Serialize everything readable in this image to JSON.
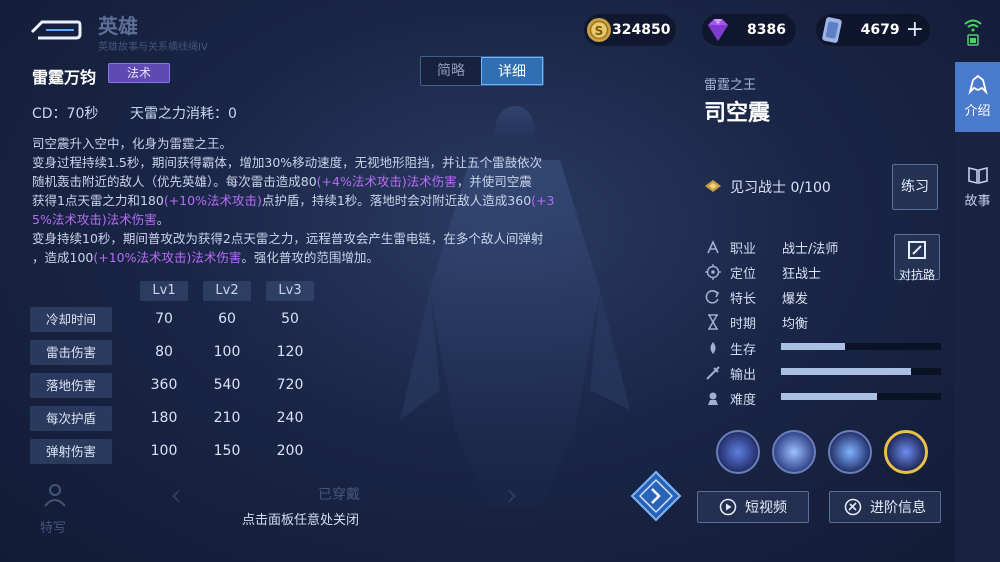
{
  "header": {
    "title": "英雄",
    "subtitle": "英雄故事与关系横线绳IV"
  },
  "currencies": {
    "coin": "324850",
    "gem": "8386",
    "ticket": "4679",
    "add_label": "+"
  },
  "skill": {
    "name": "雷霆万钧",
    "tag": "法术",
    "cd": "CD：70秒",
    "cost": "天雷之力消耗：0",
    "desc_lines": [
      [
        {
          "t": "司空震升入空中，化身为雷霆之王。",
          "h": false
        }
      ],
      [
        {
          "t": "变身过程持续1.5秒，期间获得霸体，增加30%移动速度，无视地形阻挡，并让五个雷鼓依次",
          "h": false
        }
      ],
      [
        {
          "t": "随机轰击附近的敌人（优先英雄）。每次雷击造成80",
          "h": false
        },
        {
          "t": "(+4%法术攻击)法术伤害",
          "h": true
        },
        {
          "t": "，并使司空震",
          "h": false
        }
      ],
      [
        {
          "t": "获得1点天雷之力和180",
          "h": false
        },
        {
          "t": "(+10%法术攻击)",
          "h": true
        },
        {
          "t": "点护盾，持续1秒。落地时会对附近敌人造成360",
          "h": false
        },
        {
          "t": "(+3",
          "h": true
        }
      ],
      [
        {
          "t": "5%法术攻击)法术伤害",
          "h": true
        },
        {
          "t": "。",
          "h": false
        }
      ],
      [
        {
          "t": "变身持续10秒，期间普攻改为获得2点天雷之力，远程普攻会产生雷电链，在多个敌人间弹射",
          "h": false
        }
      ],
      [
        {
          "t": "，造成100",
          "h": false
        },
        {
          "t": "(+10%法术攻击)法术伤害",
          "h": true
        },
        {
          "t": "。强化普攻的范围增加。",
          "h": false
        }
      ]
    ]
  },
  "tabs": {
    "brief": "简略",
    "detail": "详细"
  },
  "table": {
    "levels": [
      "Lv1",
      "Lv2",
      "Lv3"
    ],
    "rows": [
      {
        "label": "冷却时间",
        "values": [
          "70",
          "60",
          "50"
        ]
      },
      {
        "label": "雷击伤害",
        "values": [
          "80",
          "100",
          "120"
        ]
      },
      {
        "label": "落地伤害",
        "values": [
          "360",
          "540",
          "720"
        ]
      },
      {
        "label": "每次护盾",
        "values": [
          "180",
          "210",
          "240"
        ]
      },
      {
        "label": "弹射伤害",
        "values": [
          "100",
          "150",
          "200"
        ]
      }
    ]
  },
  "footer": {
    "close_hint": "点击面板任意处关闭",
    "worn": "已穿戴",
    "sketch": "特写"
  },
  "hero": {
    "epithet": "雷霆之王",
    "name": "司空震",
    "rank": "见习战士 0/100",
    "practice": "练习",
    "counter": "对抗路",
    "attributes": [
      {
        "label": "职业",
        "value": "战士/法师",
        "icon": "class-icon"
      },
      {
        "label": "定位",
        "value": "狂战士",
        "icon": "target-icon"
      },
      {
        "label": "特长",
        "value": "爆发",
        "icon": "specialty-icon"
      },
      {
        "label": "时期",
        "value": "均衡",
        "icon": "hourglass-icon"
      }
    ],
    "stats": [
      {
        "label": "生存",
        "value": 0.4,
        "icon": "survival-icon"
      },
      {
        "label": "输出",
        "value": 0.81,
        "icon": "damage-icon"
      },
      {
        "label": "难度",
        "value": 0.6,
        "icon": "difficulty-icon"
      }
    ]
  },
  "actions": {
    "video": "短视频",
    "advance": "进阶信息"
  },
  "side_tabs": [
    {
      "label": "介绍",
      "active": true
    },
    {
      "label": "故事",
      "active": false
    }
  ],
  "colors": {
    "highlight": "#b66cf5",
    "tag": "#5d4ab3",
    "active_tab": "#2f6fb3",
    "side_active": "#4a7acb"
  }
}
